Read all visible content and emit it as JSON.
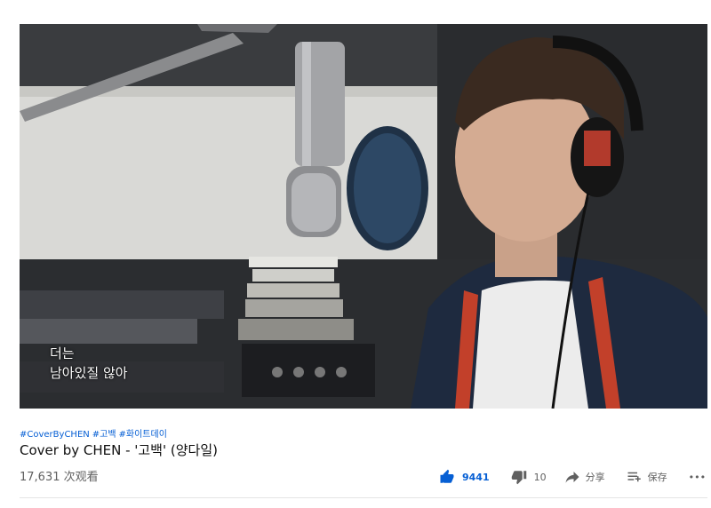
{
  "video": {
    "subtitle_line1": "더는",
    "subtitle_line2": "남아있질 않아"
  },
  "hashtags": [
    "#CoverByCHEN",
    "#고백",
    "#화이트데이"
  ],
  "title": "Cover by CHEN - '고백' (양다일)",
  "views": "17,631 次观看",
  "actions": {
    "like_count": "9441",
    "dislike_count": "10",
    "share_label": "分享",
    "save_label": "保存",
    "more_label": "•••"
  },
  "colors": {
    "accent": "#065fd4",
    "text": "#0f0f0f",
    "secondary": "#606060"
  }
}
